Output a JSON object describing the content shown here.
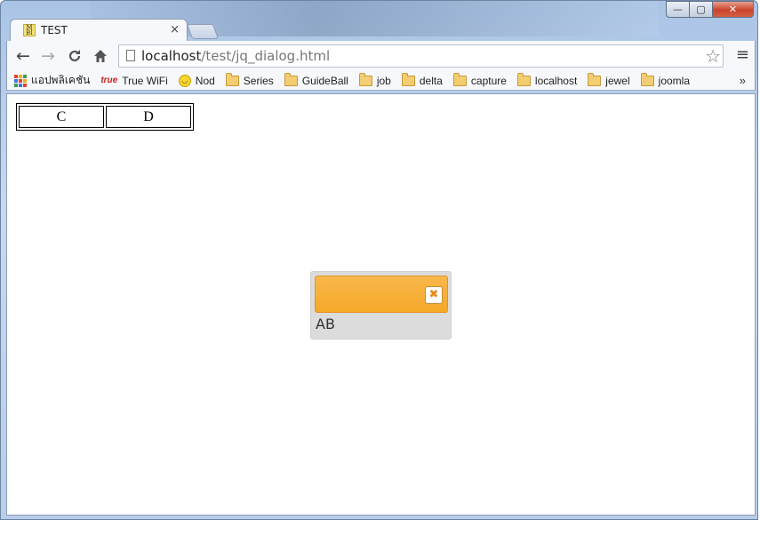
{
  "window": {
    "tab_title": "TEST",
    "tab_favicon_text": "M BI",
    "tab_close": "×",
    "minimize": "—",
    "maximize": "▢",
    "close": "✕"
  },
  "toolbar": {
    "back": "←",
    "forward": "→",
    "reload": "C",
    "home": "⌂",
    "url_host": "localhost",
    "url_path": "/test/jq_dialog.html",
    "star": "☆",
    "menu": "≡"
  },
  "bookmarks": {
    "items": [
      {
        "label": "แอปพลิเคชัน",
        "icon": "apps-icon"
      },
      {
        "label": "True WiFi",
        "icon": "true-icon",
        "icon_text": "true"
      },
      {
        "label": "Nod",
        "icon": "smiley-icon"
      },
      {
        "label": "Series",
        "icon": "folder-icon"
      },
      {
        "label": "GuideBall",
        "icon": "folder-icon"
      },
      {
        "label": "job",
        "icon": "folder-icon"
      },
      {
        "label": "delta",
        "icon": "folder-icon"
      },
      {
        "label": "capture",
        "icon": "folder-icon"
      },
      {
        "label": "localhost",
        "icon": "folder-icon"
      },
      {
        "label": "jewel",
        "icon": "folder-icon"
      },
      {
        "label": "joomla",
        "icon": "folder-icon"
      }
    ],
    "overflow": "»"
  },
  "page": {
    "table": {
      "cells": [
        "C",
        "D"
      ]
    },
    "dialog": {
      "close_glyph": "✖",
      "content": "AB"
    }
  },
  "colors": {
    "dialog_header": "#f6a828",
    "dialog_body": "#dcdcdc",
    "window_frame": "#a9c4e6"
  }
}
